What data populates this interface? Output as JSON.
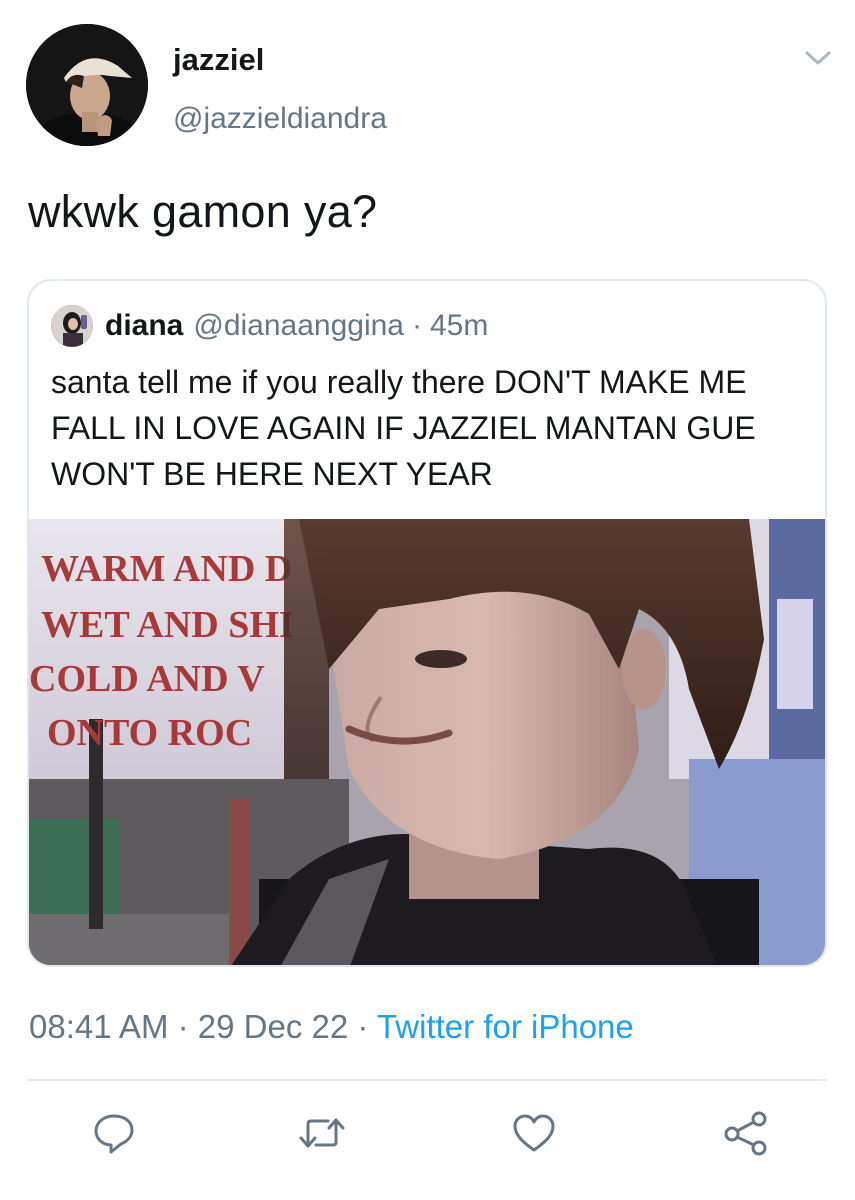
{
  "author": {
    "display_name": "jazziel",
    "handle": "@jazzieldiandra",
    "avatar_icon": "user-avatar-photo"
  },
  "tweet": {
    "text": "wkwk gamon ya?"
  },
  "quoted_tweet": {
    "display_name": "diana",
    "handle": "@dianaanggina",
    "separator": "·",
    "time": "45m",
    "text": "santa tell me if you really there DON'T MAKE ME FALL IN LOVE AGAIN IF JAZZIEL MANTAN GUE WON'T BE HERE NEXT YEAR",
    "media": {
      "sign_lines": [
        "WARM AND D",
        "WET AND SHI",
        "COLD AND V",
        "ONTO ROC"
      ]
    }
  },
  "meta": {
    "time": "08:41 AM",
    "separator": "·",
    "date": "29 Dec 22",
    "source": "Twitter for iPhone"
  },
  "colors": {
    "text": "#14171a",
    "secondary": "#657786",
    "link": "#1da1f2",
    "border": "#e1e8ed"
  },
  "actions": [
    "reply-icon",
    "retweet-icon",
    "like-icon",
    "share-icon"
  ]
}
